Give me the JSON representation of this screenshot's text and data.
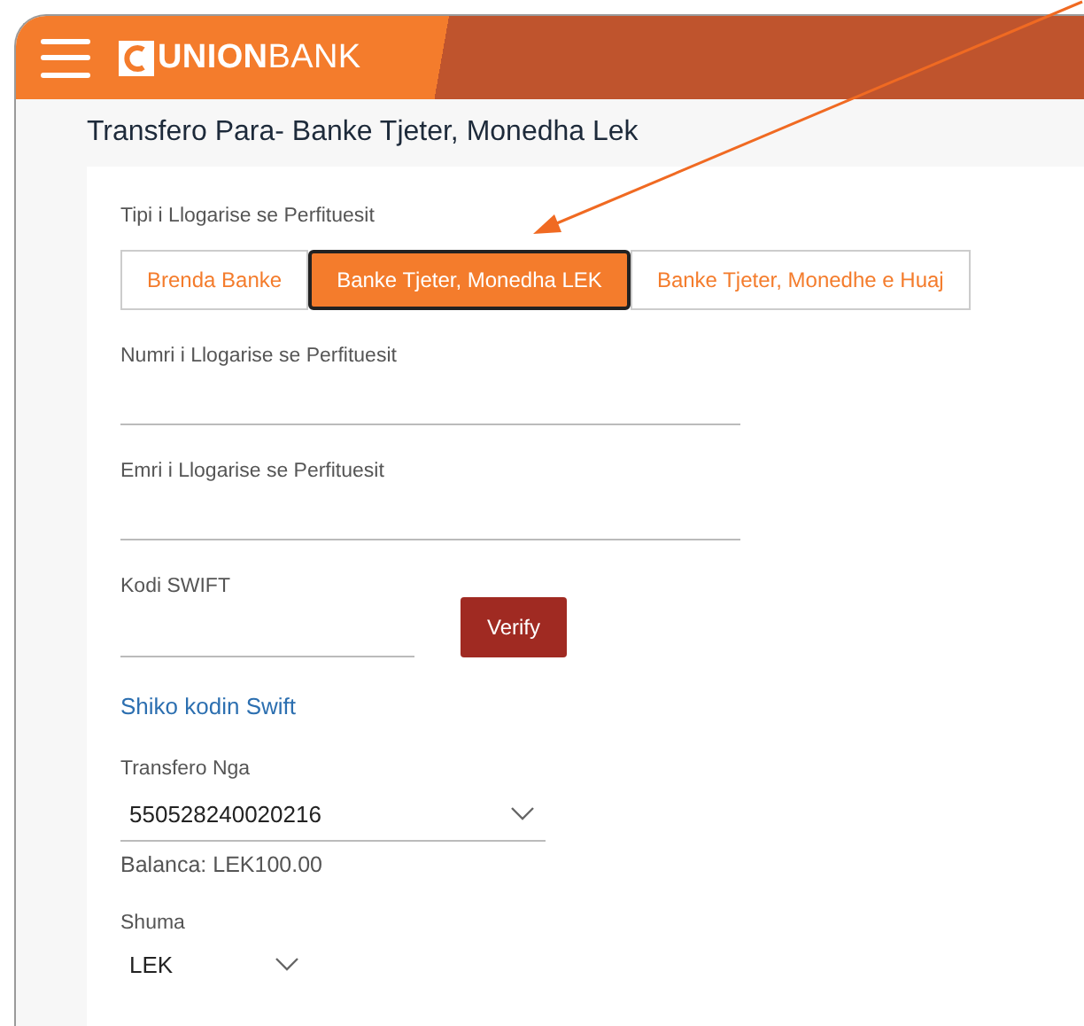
{
  "header": {
    "logo": "**UNION**BANK"
  },
  "page_title": "Transfero Para- Banke Tjeter, Monedha Lek",
  "account_type": {
    "label": "Tipi i Llogarise se Perfituesit",
    "tabs": [
      {
        "label": "Brenda Banke",
        "selected": false
      },
      {
        "label": "Banke Tjeter, Monedha LEK",
        "selected": true
      },
      {
        "label": "Banke Tjeter, Monedhe e Huaj",
        "selected": false
      }
    ]
  },
  "fields": [
    {
      "label": "Numri i Llogarise se Perfituesit"
    },
    {
      "label": "Emri i Llogarise se Perfituesit"
    }
  ],
  "swift": {
    "label": "Kodi SWIFT",
    "button": "Verify",
    "link": "Shiko kodin Swift"
  },
  "transfer_from": {
    "label": "Transfero Nga",
    "value": "550528240020216",
    "balance": "Balanca: LEK100.00"
  },
  "amount": {
    "label": "Shuma",
    "currency": "LEK"
  }
}
